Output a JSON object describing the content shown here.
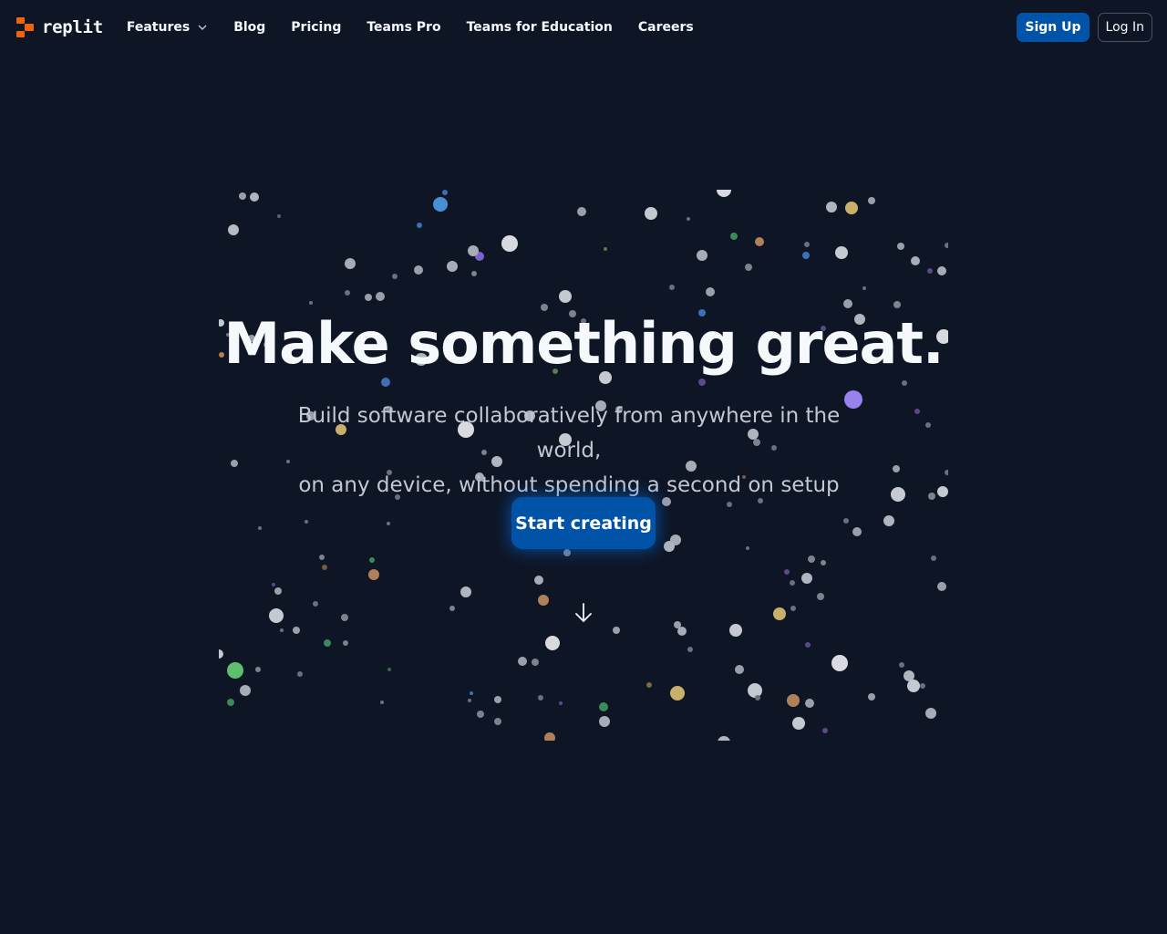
{
  "header": {
    "logo_text": "replit",
    "nav": [
      {
        "label": "Features",
        "icon": "chevron-down-icon"
      },
      {
        "label": "Blog"
      },
      {
        "label": "Pricing"
      },
      {
        "label": "Teams Pro"
      },
      {
        "label": "Teams for Education"
      },
      {
        "label": "Careers"
      }
    ],
    "signup_label": "Sign Up",
    "login_label": "Log In"
  },
  "hero": {
    "title": "Make something great.",
    "subtitle_line1": "Build software collaboratively from anywhere in the world,",
    "subtitle_line2": "on any device, without spending a second on setup",
    "cta_label": "Start creating",
    "scroll_icon": "arrow-down-icon"
  },
  "colors": {
    "background": "#0e1525",
    "brand": "#f26207",
    "primary": "#0053a6",
    "text": "#f5f9fc",
    "muted": "#c2c8d3"
  }
}
